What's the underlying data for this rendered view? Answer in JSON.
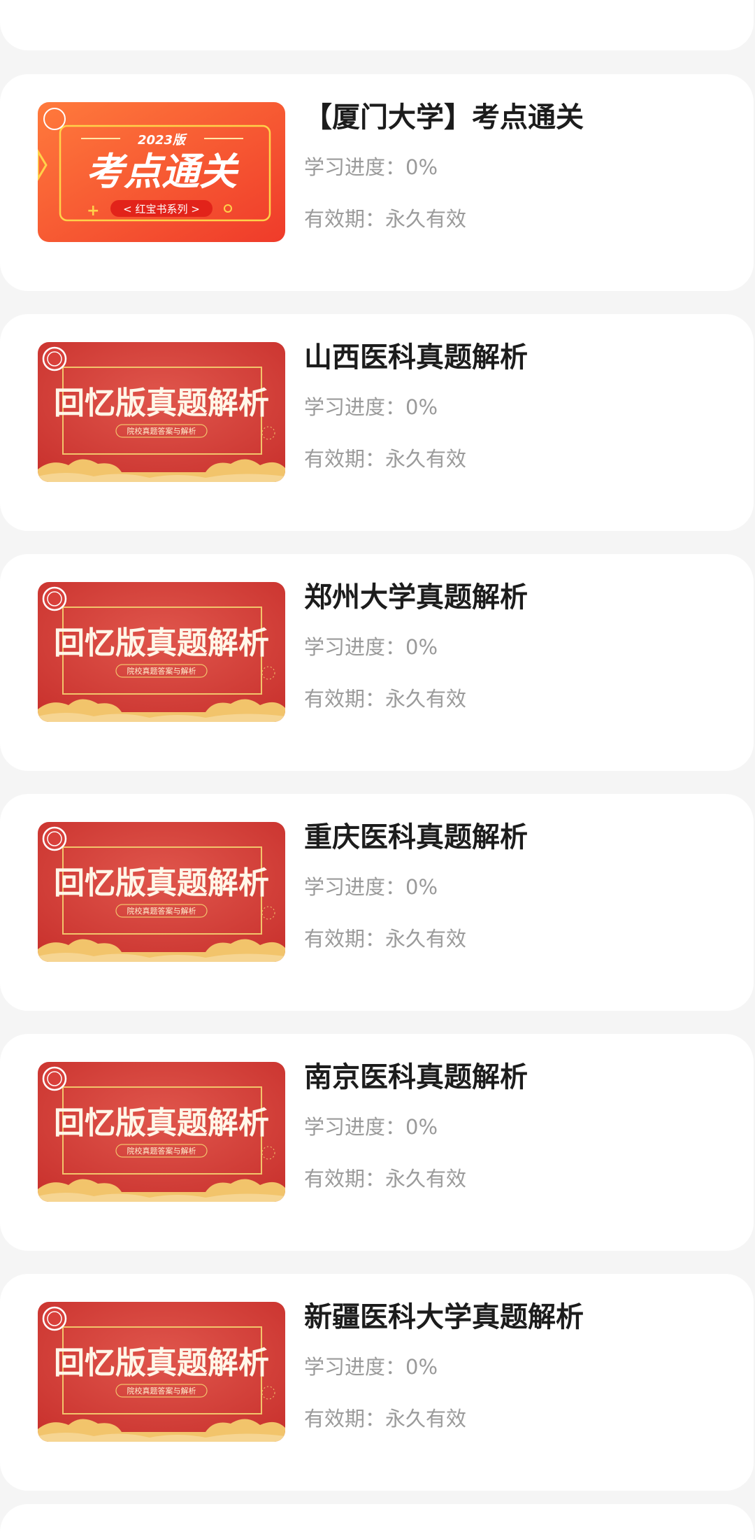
{
  "courses": [
    {
      "title": "【厦门大学】考点通关",
      "progress_label": "学习进度：",
      "progress_value": "0%",
      "validity_label": "有效期：",
      "validity_value": "永久有效",
      "thumbnail": {
        "style": "orange",
        "year_label": "2023版",
        "main_text": "考点通关",
        "sub_text": "< 红宝书系列 >"
      }
    },
    {
      "title": "山西医科真题解析",
      "progress_label": "学习进度：",
      "progress_value": "0%",
      "validity_label": "有效期：",
      "validity_value": "永久有效",
      "thumbnail": {
        "style": "red",
        "main_text": "回忆版真题解析",
        "sub_text": "院校真题答案与解析"
      }
    },
    {
      "title": "郑州大学真题解析",
      "progress_label": "学习进度：",
      "progress_value": "0%",
      "validity_label": "有效期：",
      "validity_value": "永久有效",
      "thumbnail": {
        "style": "red",
        "main_text": "回忆版真题解析",
        "sub_text": "院校真题答案与解析"
      }
    },
    {
      "title": "重庆医科真题解析",
      "progress_label": "学习进度：",
      "progress_value": "0%",
      "validity_label": "有效期：",
      "validity_value": "永久有效",
      "thumbnail": {
        "style": "red",
        "main_text": "回忆版真题解析",
        "sub_text": "院校真题答案与解析"
      }
    },
    {
      "title": "南京医科真题解析",
      "progress_label": "学习进度：",
      "progress_value": "0%",
      "validity_label": "有效期：",
      "validity_value": "永久有效",
      "thumbnail": {
        "style": "red",
        "main_text": "回忆版真题解析",
        "sub_text": "院校真题答案与解析"
      }
    },
    {
      "title": "新疆医科大学真题解析",
      "progress_label": "学习进度：",
      "progress_value": "0%",
      "validity_label": "有效期：",
      "validity_value": "永久有效",
      "thumbnail": {
        "style": "red",
        "main_text": "回忆版真题解析",
        "sub_text": "院校真题答案与解析"
      }
    }
  ],
  "colors": {
    "page_background": "#f5f5f5",
    "card_background": "#ffffff",
    "title_text": "#1c1c1c",
    "meta_text": "#9a9a9a",
    "thumb_red": "#d8403b",
    "thumb_orange": "#f35a2c",
    "thumb_gold": "#f2c46b"
  }
}
